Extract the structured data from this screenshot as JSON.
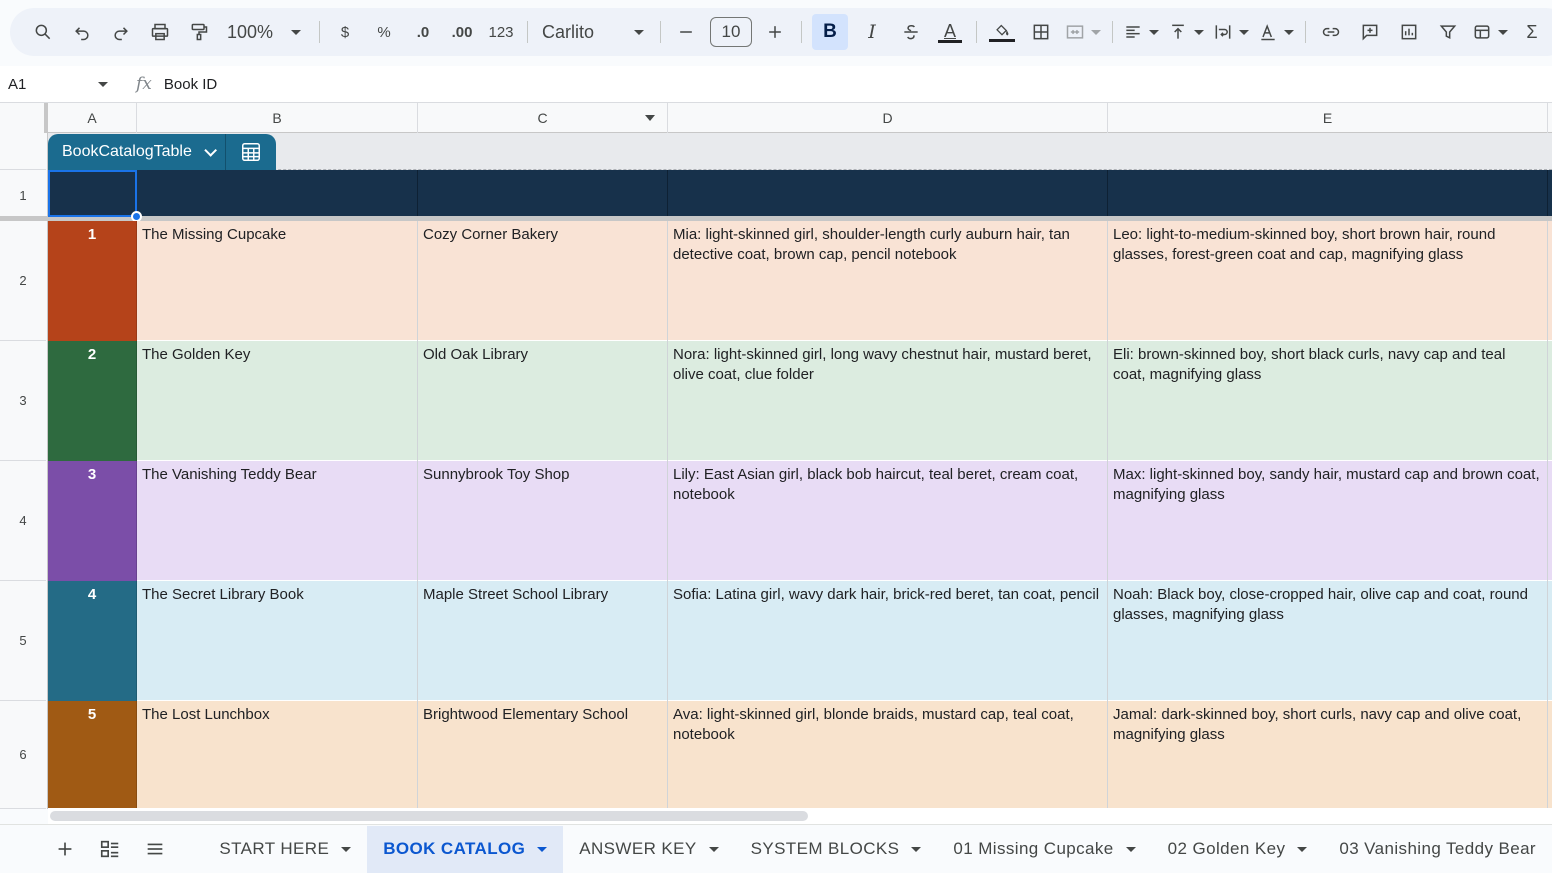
{
  "toolbar": {
    "zoom": "100%",
    "currency": "$",
    "percent": "%",
    "decrease_decimal": ".0",
    "increase_decimal": ".00",
    "number_format": "123",
    "font": "Carlito",
    "font_size": "10",
    "bold": "B",
    "italic": "I",
    "text_color": "A",
    "sum": "Σ"
  },
  "formula_bar": {
    "cell_ref": "A1",
    "fx": "fx",
    "value": "Book ID"
  },
  "columns": [
    "A",
    "B",
    "C",
    "D",
    "E"
  ],
  "row_numbers": [
    "1",
    "2",
    "3",
    "4",
    "5",
    "6"
  ],
  "table": {
    "name": "BookCatalogTable",
    "header_color": "#17314b",
    "tab_color": "#1b6b8f"
  },
  "rows": [
    {
      "id": "1",
      "title": "The Missing Cupcake",
      "setting": "Cozy Corner Bakery",
      "detective_a": "Mia: light-skinned girl, shoulder-length curly auburn hair, tan detective coat, brown cap, pencil notebook",
      "detective_b": "Leo: light-to-medium-skinned boy, short brown hair, round glasses, forest-green coat and cap, magnifying glass",
      "id_color": "#b5431a",
      "row_color": "#f9e3d5"
    },
    {
      "id": "2",
      "title": "The Golden Key",
      "setting": "Old Oak Library",
      "detective_a": "Nora: light-skinned girl, long wavy chestnut hair, mustard beret, olive coat, clue folder",
      "detective_b": "Eli: brown-skinned boy, short black curls, navy cap and teal coat, magnifying glass",
      "id_color": "#2e6a3f",
      "row_color": "#dcece0"
    },
    {
      "id": "3",
      "title": "The Vanishing Teddy Bear",
      "setting": "Sunnybrook Toy Shop",
      "detective_a": "Lily: East Asian girl, black bob haircut, teal beret, cream coat, notebook",
      "detective_b": "Max: light-skinned boy, sandy hair, mustard cap and brown coat, magnifying glass",
      "id_color": "#7b4ea8",
      "row_color": "#e8dcf5"
    },
    {
      "id": "4",
      "title": "The Secret Library Book",
      "setting": "Maple Street School Library",
      "detective_a": "Sofia: Latina girl, wavy dark hair, brick-red beret, tan coat, pencil",
      "detective_b": "Noah: Black boy, close-cropped hair, olive cap and coat, round glasses, magnifying glass",
      "id_color": "#246b86",
      "row_color": "#d8ecf4"
    },
    {
      "id": "5",
      "title": "The Lost Lunchbox",
      "setting": "Brightwood Elementary School",
      "detective_a": "Ava: light-skinned girl, blonde braids, mustard cap, teal coat, notebook",
      "detective_b": "Jamal: dark-skinned boy, short curls, navy cap and olive coat, magnifying glass",
      "id_color": "#a05a14",
      "row_color": "#f8e3cd"
    }
  ],
  "sheets": [
    {
      "label": "START HERE",
      "active": false
    },
    {
      "label": "BOOK CATALOG",
      "active": true
    },
    {
      "label": "ANSWER KEY",
      "active": false
    },
    {
      "label": "SYSTEM BLOCKS",
      "active": false
    },
    {
      "label": "01 Missing Cupcake",
      "active": false
    },
    {
      "label": "02 Golden Key",
      "active": false
    },
    {
      "label": "03 Vanishing Teddy Bear",
      "active": false
    }
  ],
  "colors": {
    "selection": "#1a73e8",
    "active_tab_text": "#0b57d0",
    "active_tab_bg": "#e1e9f7"
  }
}
